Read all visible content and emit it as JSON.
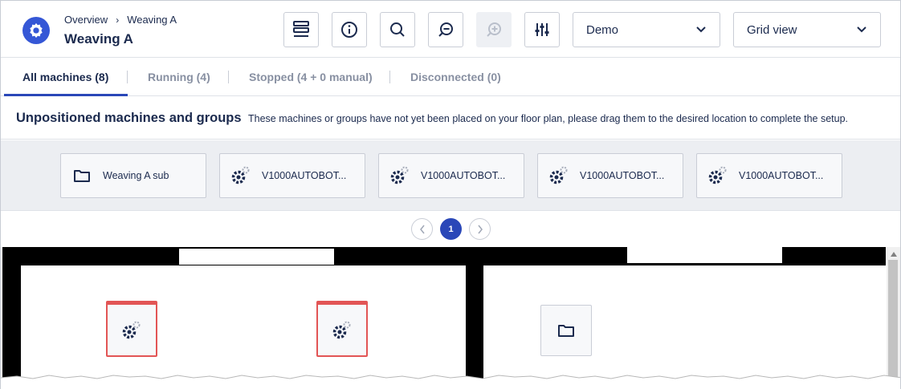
{
  "header": {
    "breadcrumb": [
      "Overview",
      "Weaving A"
    ],
    "title": "Weaving A",
    "dropdowns": {
      "site": "Demo",
      "view": "Grid view"
    },
    "toolbar_icons": [
      "layers-icon",
      "info-icon",
      "search-icon",
      "zoom-out-icon",
      "zoom-in-icon",
      "sliders-icon"
    ]
  },
  "tabs": [
    {
      "label": "All machines (8)",
      "active": true
    },
    {
      "label": "Running (4)",
      "active": false
    },
    {
      "label": "Stopped (4 + 0 manual)",
      "active": false
    },
    {
      "label": "Disconnected (0)",
      "active": false
    }
  ],
  "unpositioned": {
    "title": "Unpositioned machines and groups",
    "description": "These machines or groups have not yet been placed on your floor plan, please drag them to the desired location to complete the setup.",
    "items": [
      {
        "label": "Weaving A sub",
        "icon": "folder-icon"
      },
      {
        "label": "V1000AUTOBOT...",
        "icon": "machine-gear-icon"
      },
      {
        "label": "V1000AUTOBOT...",
        "icon": "machine-gear-icon"
      },
      {
        "label": "V1000AUTOBOT...",
        "icon": "machine-gear-icon"
      },
      {
        "label": "V1000AUTOBOT...",
        "icon": "machine-gear-icon"
      }
    ]
  },
  "pagination": {
    "current": "1"
  },
  "colors": {
    "accent": "#2a47b8",
    "logo": "#3557d6",
    "stopped": "#e25555",
    "text": "#1b2a4e"
  }
}
